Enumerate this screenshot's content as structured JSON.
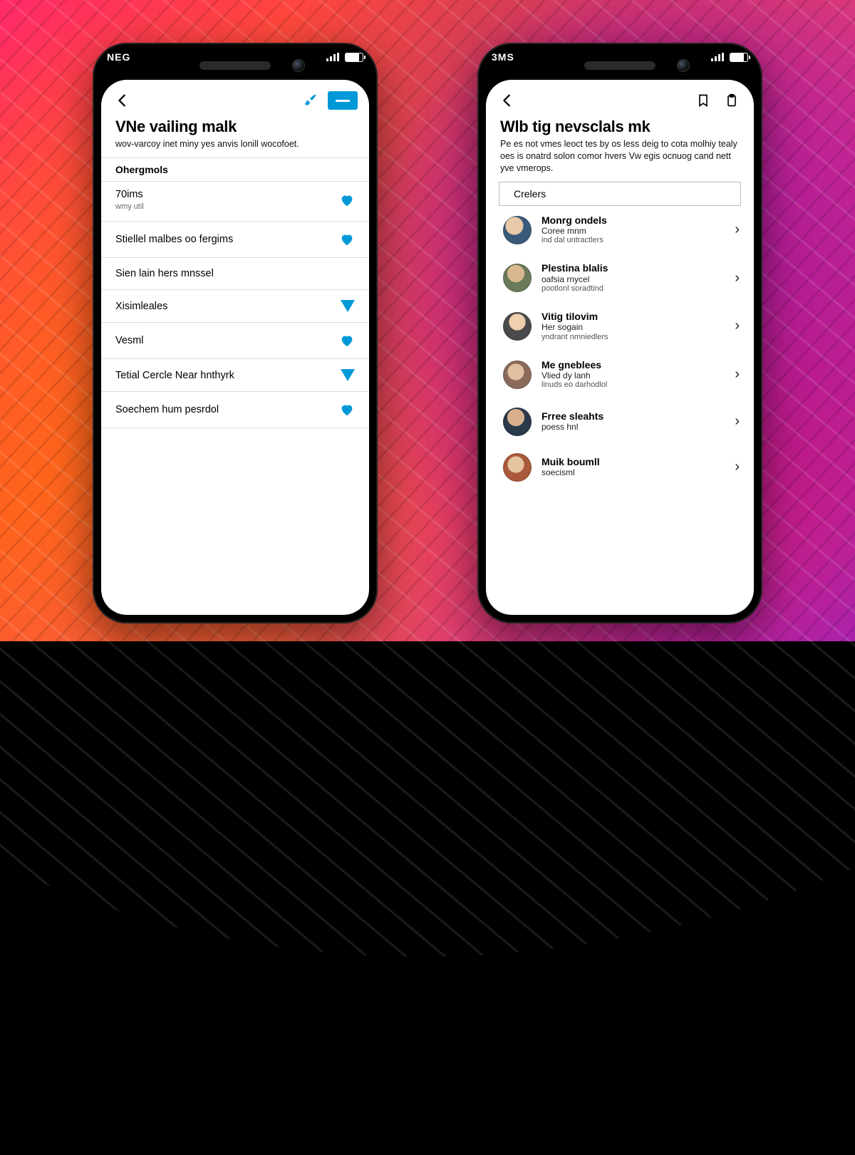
{
  "accent": "#0099d8",
  "phoneA": {
    "carrier": "NEG",
    "title": "VNe vailing malk",
    "subtitle": "wov-varcoy inet miny yes anvis lonill wocofoet.",
    "section": "Ohergmols",
    "items": [
      {
        "label": "70ims",
        "sub": "wmy util",
        "glyph": "heart"
      },
      {
        "label": "Stiellel malbes oo fergims",
        "glyph": "heart"
      },
      {
        "label": "Sien lain hers mnssel",
        "glyph": ""
      },
      {
        "label": "Xisimleales",
        "glyph": "tri"
      },
      {
        "label": "Vesml",
        "glyph": "heart"
      },
      {
        "label": "Tetial Cercle Near hnthyrk",
        "glyph": "tri"
      },
      {
        "label": "Soechem hum pesrdol",
        "glyph": "heart"
      }
    ]
  },
  "phoneB": {
    "carrier": "3MS",
    "title": "Wlb tig nevsclals mk",
    "subtitle": "Pe es not vmes leoct tes by os less deig to cota molhiy tealy oes is onatrd solon comor hvers Vw egis ocnuog cand nett yve vmerops.",
    "section": "Crelers",
    "items": [
      {
        "name": "Monrg ondels",
        "line2": "Coree mnm",
        "line3": "ind dal untractlers"
      },
      {
        "name": "Plestina blalis",
        "line2": "oafsia rnycel",
        "line3": "pootlonl soradtind"
      },
      {
        "name": "Vitig tilovim",
        "line2": "Her sogain",
        "line3": "yndrant nmniedlers"
      },
      {
        "name": "Me gneblees",
        "line2": "Vlied dy lanh",
        "line3": "linuds eo darhodlol"
      },
      {
        "name": "Frree sleahts",
        "line2": "poess hnl",
        "line3": ""
      },
      {
        "name": "Muik boumll",
        "line2": "soecisml",
        "line3": ""
      }
    ]
  }
}
